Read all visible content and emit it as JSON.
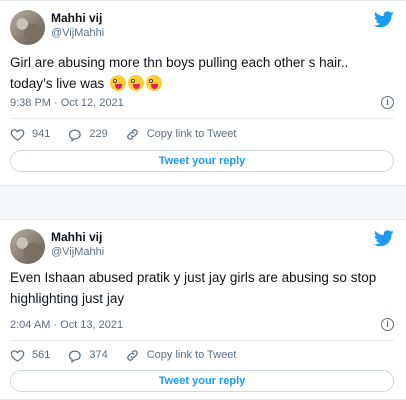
{
  "tweets": [
    {
      "name": "Mahhi vij",
      "handle": "@VijMahhi",
      "text": "Girl are abusing more thn boys pulling each other s hair.. today’s live was",
      "emoji_count": 3,
      "time": "9:38 PM · Oct 12, 2021",
      "likes": "941",
      "replies": "229",
      "copy_link_label": "Copy link to Tweet",
      "reply_button_label": "Tweet your reply"
    },
    {
      "name": "Mahhi vij",
      "handle": "@VijMahhi",
      "text": "Even Ishaan abused pratik y just jay girls are abusing so stop highlighting just jay",
      "time": "2:04 AM · Oct 13, 2021",
      "likes": "561",
      "replies": "374",
      "copy_link_label": "Copy link to Tweet",
      "reply_button_label": "Tweet your reply"
    }
  ],
  "icons": {
    "bird": "twitter-bird-icon",
    "info": "info-icon",
    "like": "heart-icon",
    "reply": "reply-icon",
    "link": "link-icon"
  },
  "colors": {
    "accent": "#1d9bf0",
    "muted": "#5b7083"
  }
}
